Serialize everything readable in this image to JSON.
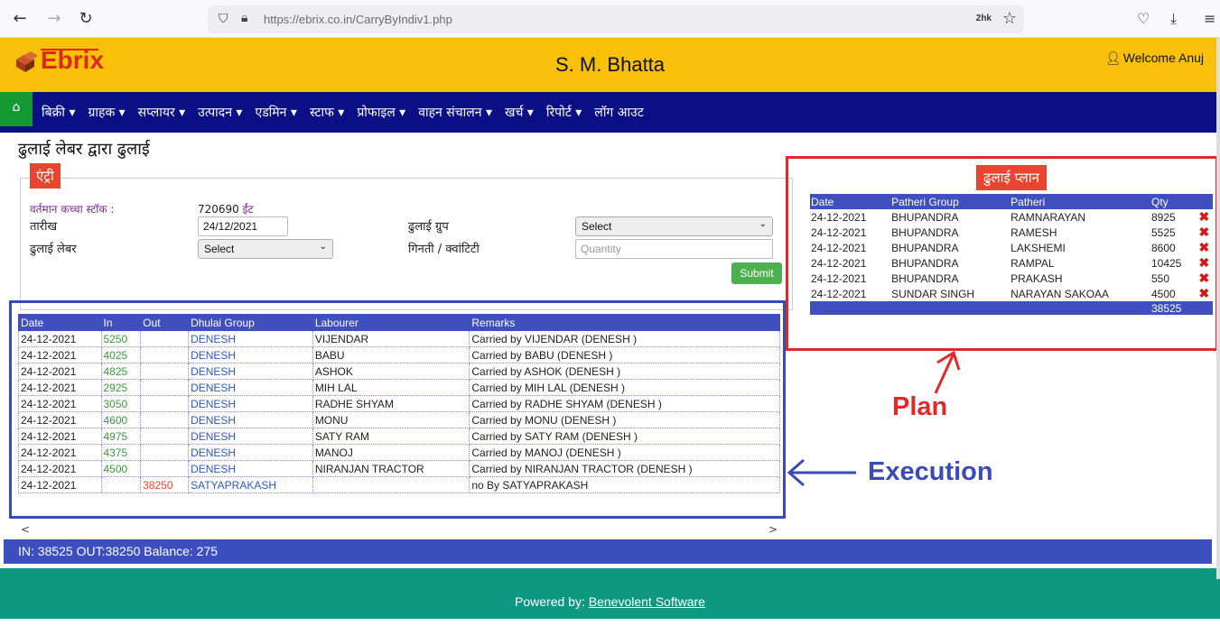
{
  "browser": {
    "url": "https://ebrix.co.in/CarryByIndiv1.php",
    "zoom": "2hk",
    "back_icon": "back-arrow-icon",
    "forward_icon": "forward-arrow-icon",
    "reload_icon": "reload-icon"
  },
  "header": {
    "logo": "Ebrix",
    "title": "S. M. Bhatta",
    "welcome": "Welcome Anuj"
  },
  "menu": {
    "items": [
      "बिक्री ▾",
      "ग्राहक ▾",
      "सप्लायर ▾",
      "उत्पादन ▾",
      "एडमिन ▾",
      "स्टाफ ▾",
      "प्रोफाइल ▾",
      "वाहन संचालन ▾",
      "खर्च ▾",
      "रिपोर्ट ▾",
      "लॉग आउट"
    ]
  },
  "page": {
    "heading": "ढुलाई लेबर द्वारा ढुलाई",
    "entry_tag": "एंट्री"
  },
  "form": {
    "stock_label": "वर्तमान कच्चा स्टॉक :",
    "stock_value": "720690",
    "stock_unit": "ईंट",
    "date_label": "तारीख",
    "date_value": "24/12/2021",
    "group_label": "ढुलाई ग्रुप",
    "group_value": "Select",
    "labour_label": "ढुलाई लेबर",
    "labour_value": "Select",
    "qty_label": "गिनती / क्वांटिटी",
    "qty_placeholder": "Quantity",
    "submit_label": "Submit"
  },
  "exec": {
    "headers": [
      "Date",
      "In",
      "Out",
      "Dhulai Group",
      "Labourer",
      "Remarks"
    ],
    "rows": [
      [
        "24-12-2021",
        "5250",
        "",
        "DENESH",
        "VIJENDAR",
        "Carried by VIJENDAR (DENESH )"
      ],
      [
        "24-12-2021",
        "4025",
        "",
        "DENESH",
        "BABU",
        "Carried by BABU (DENESH )"
      ],
      [
        "24-12-2021",
        "4825",
        "",
        "DENESH",
        "ASHOK",
        "Carried by ASHOK (DENESH )"
      ],
      [
        "24-12-2021",
        "2925",
        "",
        "DENESH",
        "MIH LAL",
        "Carried by MIH LAL (DENESH )"
      ],
      [
        "24-12-2021",
        "3050",
        "",
        "DENESH",
        "RADHE SHYAM",
        "Carried by RADHE SHYAM (DENESH )"
      ],
      [
        "24-12-2021",
        "4600",
        "",
        "DENESH",
        "MONU",
        "Carried by MONU (DENESH )"
      ],
      [
        "24-12-2021",
        "4975",
        "",
        "DENESH",
        "SATY RAM",
        "Carried by SATY RAM (DENESH )"
      ],
      [
        "24-12-2021",
        "4375",
        "",
        "DENESH",
        "MANOJ",
        "Carried by MANOJ (DENESH )"
      ],
      [
        "24-12-2021",
        "4500",
        "",
        "DENESH",
        "NIRANJAN TRACTOR",
        "Carried by NIRANJAN TRACTOR (DENESH )"
      ],
      [
        "24-12-2021",
        "",
        "38250",
        "SATYAPRAKASH",
        "",
        "no By SATYAPRAKASH"
      ]
    ]
  },
  "balance": "IN: 38525   OUT:38250   Balance: 275",
  "footer": {
    "prefix": "Powered by: ",
    "link": "Benevolent Software"
  },
  "plan": {
    "tag": "ढुलाई प्लान",
    "headers": [
      "Date",
      "Patheri Group",
      "Patheri",
      "Qty",
      ""
    ],
    "rows": [
      [
        "24-12-2021",
        "BHUPANDRA",
        "RAMNARAYAN",
        "8925"
      ],
      [
        "24-12-2021",
        "BHUPANDRA",
        "RAMESH",
        "5525"
      ],
      [
        "24-12-2021",
        "BHUPANDRA",
        "LAKSHEMI",
        "8600"
      ],
      [
        "24-12-2021",
        "BHUPANDRA",
        "RAMPAL",
        "10425"
      ],
      [
        "24-12-2021",
        "BHUPANDRA",
        "PRAKASH",
        "550"
      ],
      [
        "24-12-2021",
        "SUNDAR SINGH",
        "NARAYAN SAKOAA",
        "4500"
      ]
    ],
    "total": "38525"
  },
  "annotations": {
    "plan": "Plan",
    "execution": "Execution",
    "plan_color": "#e02a2a",
    "execution_color": "#3a4ab8"
  }
}
